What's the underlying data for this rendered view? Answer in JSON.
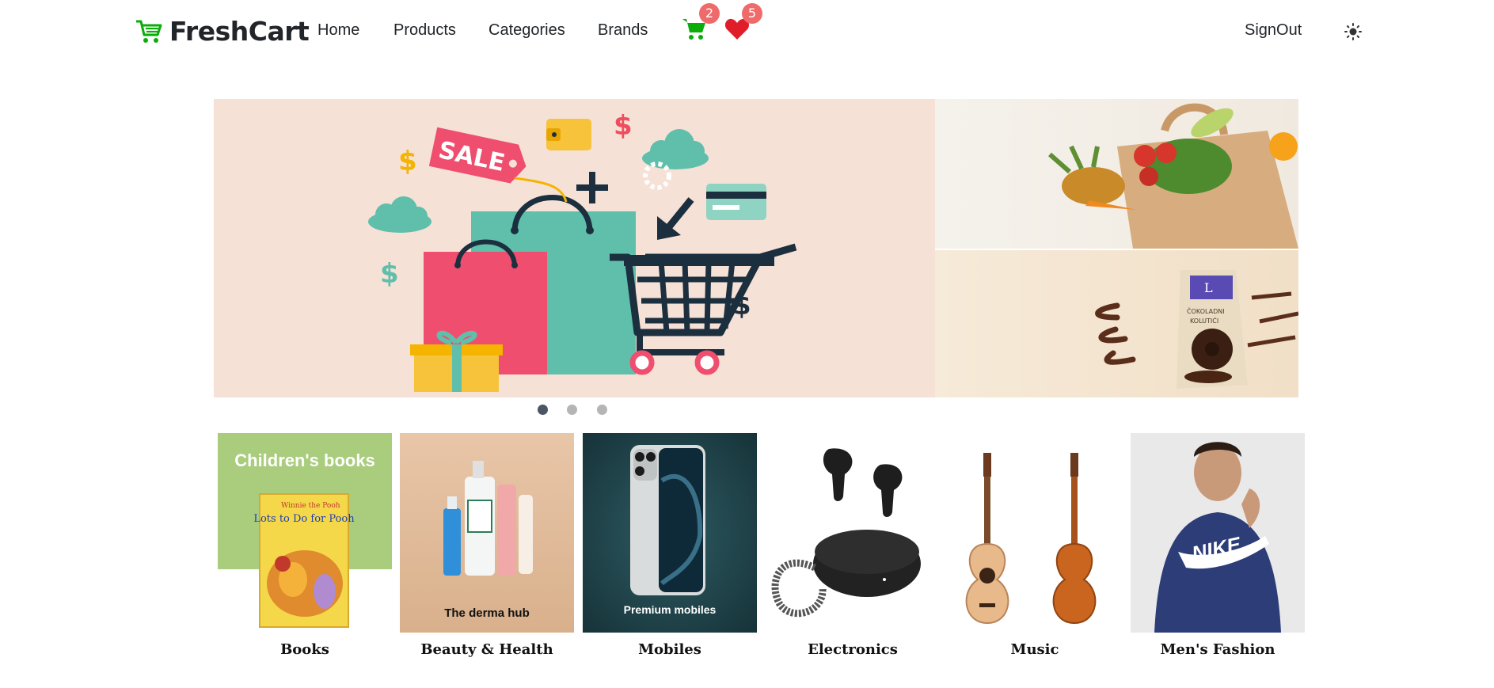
{
  "brand": {
    "name": "FreshCart",
    "logo_icon": "cart-icon"
  },
  "nav": {
    "links": [
      "Home",
      "Products",
      "Categories",
      "Brands"
    ],
    "cart_count": "2",
    "wishlist_count": "5",
    "signout": "SignOut",
    "theme_icon": "sun-icon"
  },
  "hero": {
    "sale_tag": "SALE",
    "dots": 3,
    "active_dot": 0
  },
  "categories": [
    {
      "name": "Books",
      "overlay": "Children's books",
      "book_title": "Lots to Do for Pooh",
      "book_brand": "Winnie the Pooh"
    },
    {
      "name": "Beauty & Health",
      "overlay": "The derma hub"
    },
    {
      "name": "Mobiles",
      "overlay": "Premium mobiles"
    },
    {
      "name": "Electronics"
    },
    {
      "name": "Music"
    },
    {
      "name": "Men's Fashion",
      "shirt_text": "NIKE"
    }
  ],
  "colors": {
    "brand_green": "#0aad0a",
    "heart_red": "#e11d2a",
    "badge_red": "#ef6a6a",
    "hero_bg": "#f6e1d7"
  }
}
